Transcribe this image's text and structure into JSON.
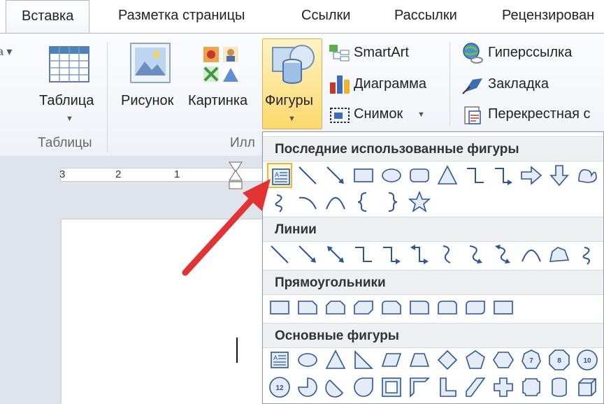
{
  "tabs": [
    "Вставка",
    "Разметка страницы",
    "Ссылки",
    "Рассылки",
    "Рецензирован"
  ],
  "ribbon": {
    "table_label": "Таблица",
    "tables_group": "Таблицы",
    "picture_label": "Рисунок",
    "clipart_label": "Картинка",
    "shapes_label": "Фигуры",
    "illustrations_group": "Илл",
    "smartart_label": "SmartArt",
    "chart_label": "Диаграмма",
    "screenshot_label": "Снимок",
    "hyperlink_label": "Гиперссылка",
    "bookmark_label": "Закладка",
    "crossref_label": "Перекрестная с"
  },
  "ruler": {
    "numbers": [
      "3",
      "2",
      "1"
    ]
  },
  "dropdown": {
    "sections": {
      "recent": "Последние использованные фигуры",
      "lines": "Линии",
      "rectangles": "Прямоугольники",
      "basic": "Основные фигуры"
    },
    "basic_row2_label": "12",
    "octagon_labels": [
      "7",
      "8",
      "10"
    ]
  },
  "colors": {
    "accent": "#e8b73c",
    "arrow": "#e23232",
    "icon_blue": "#2b5797"
  }
}
